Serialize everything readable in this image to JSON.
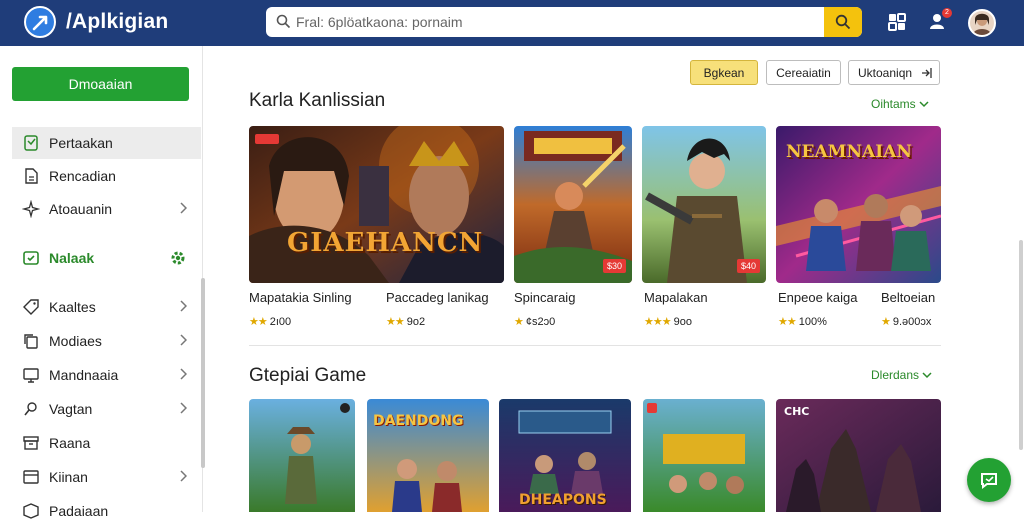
{
  "app": {
    "title": "/Aplkigian"
  },
  "search": {
    "placeholder": "Fral: 6plöatkaona: pornaim"
  },
  "header": {
    "notification_count": "2"
  },
  "sidebar": {
    "primary_button": "Dmoaaian",
    "items_top": [
      {
        "label": "Pertaakan",
        "icon": "gamepad-icon",
        "active": true
      },
      {
        "label": "Rencadian",
        "icon": "document-icon"
      },
      {
        "label": "Atoauanin",
        "icon": "sparkle-icon",
        "chevron": true
      }
    ],
    "section": {
      "label": "Nalaak",
      "icon": "grid-icon"
    },
    "items_bottom": [
      {
        "label": "Kaaltes",
        "icon": "tag-icon",
        "chevron": true
      },
      {
        "label": "Modiaes",
        "icon": "copy-icon",
        "chevron": true
      },
      {
        "label": "Mandnaaia",
        "icon": "monitor-icon",
        "chevron": true
      },
      {
        "label": "Vagtan",
        "icon": "pin-icon",
        "chevron": true
      },
      {
        "label": "Raana",
        "icon": "archive-icon"
      },
      {
        "label": "Kiinan",
        "icon": "window-icon",
        "chevron": true
      },
      {
        "label": "Padaiaan",
        "icon": "box-icon"
      }
    ]
  },
  "filters": [
    {
      "label": "Bgkean",
      "active": true
    },
    {
      "label": "Cereaiatin"
    },
    {
      "label": "Uktoaniqn"
    }
  ],
  "section1": {
    "title": "Karla Kanlissian",
    "more": "Oihtams",
    "cards": [
      {
        "title": "Mapatakia Sinling",
        "rating": "2ı00",
        "art_text": "GIAEHANCN",
        "price": ""
      },
      {
        "title": "Paccadeg lanikag",
        "rating": "9o2",
        "art_text": "",
        "price": ""
      },
      {
        "title": "Spincaraig",
        "rating": "¢s2ɔ0",
        "art_text": "",
        "price": "$30"
      },
      {
        "title": "Mapalakan",
        "rating": "9oo",
        "art_text": "",
        "price": "$40"
      },
      {
        "title": "Enpeoe kaiga",
        "rating": "100%",
        "art_text": "NEAMNAIAN",
        "price": ""
      },
      {
        "title": "Beltoeian",
        "rating": "9.ǝ00ɔx",
        "art_text": "",
        "price": ""
      }
    ]
  },
  "section2": {
    "title": "Gtepiai Game",
    "more": "Dlerdans",
    "cards": [
      {
        "art_text": ""
      },
      {
        "art_text": "DAENDONG"
      },
      {
        "art_text": "DHEAPONS"
      },
      {
        "art_text": ""
      },
      {
        "art_text": "CHC"
      }
    ]
  },
  "colors": {
    "topbar": "#1f3d7a",
    "accent_green": "#23a133",
    "search_button": "#f4c20d"
  }
}
